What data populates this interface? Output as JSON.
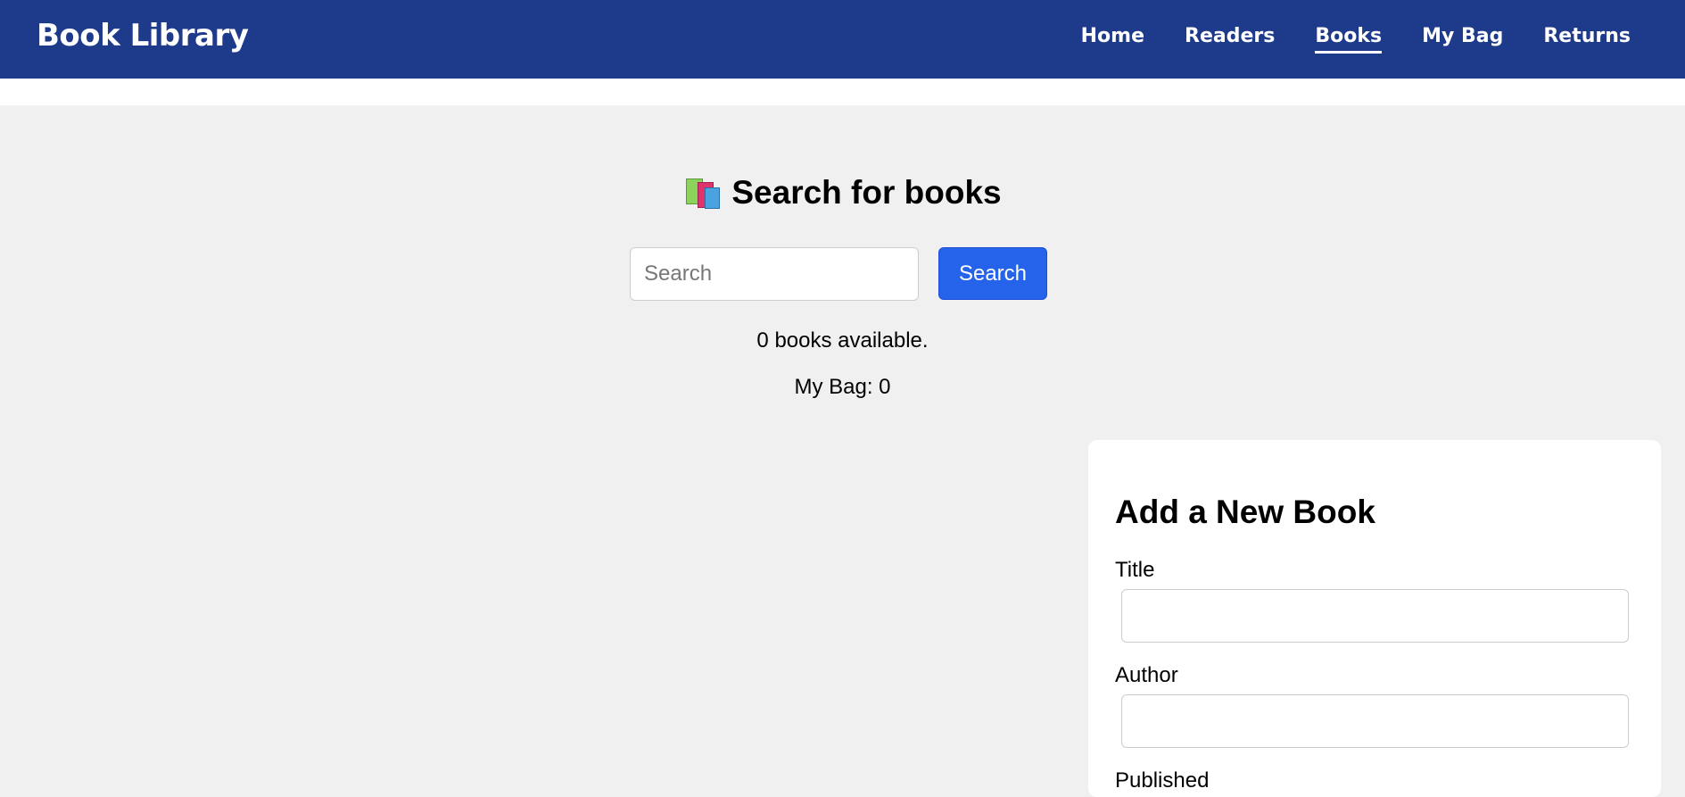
{
  "navbar": {
    "brand": "Book Library",
    "links": [
      {
        "label": "Home",
        "active": false
      },
      {
        "label": "Readers",
        "active": false
      },
      {
        "label": "Books",
        "active": true
      },
      {
        "label": "My Bag",
        "active": false
      },
      {
        "label": "Returns",
        "active": false
      }
    ],
    "background_color": "#1e3a8a"
  },
  "search": {
    "heading": "Search for books",
    "heading_icon": "books-icon",
    "placeholder": "Search",
    "value": "",
    "button_label": "Search",
    "button_color": "#2563eb",
    "books_available": "0 books available.",
    "bag_status": "My Bag: 0"
  },
  "add_book": {
    "title": "Add a New Book",
    "fields": [
      {
        "label": "Title",
        "value": ""
      },
      {
        "label": "Author",
        "value": ""
      },
      {
        "label": "Published",
        "value": ""
      }
    ]
  }
}
